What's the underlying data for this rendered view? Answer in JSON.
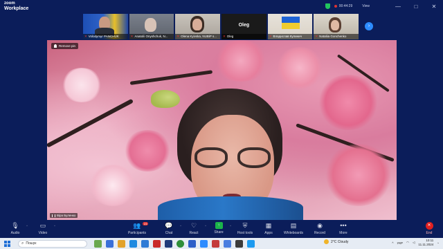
{
  "app": {
    "brand_line1": "zoom",
    "brand_line2": "Workplace"
  },
  "titlebar": {
    "timer": "00:44:29",
    "view_label": "View",
    "minimize": "—",
    "maximize": "□",
    "close": "✕"
  },
  "thumbnails": [
    {
      "name": "Volodymyr PANCHUK"
    },
    {
      "name": "Anatolii Onyshchuk, N..."
    },
    {
      "name": "Olena Kyivska, NUBiP s..."
    },
    {
      "name": "Oleg",
      "center_name": "Oleg"
    },
    {
      "name": "Владислав Кулинич"
    },
    {
      "name": "Nataliia Gonchenko"
    }
  ],
  "video": {
    "remove_pin_label": "Remove pin",
    "speaker_label": "Віра Буленко"
  },
  "toolbar": {
    "items": [
      {
        "label": "Audio",
        "icon": "microphone-icon"
      },
      {
        "label": "Video",
        "icon": "camera-icon"
      },
      {
        "label": "Participants",
        "icon": "participants-icon",
        "badge": "23"
      },
      {
        "label": "Chat",
        "icon": "chat-icon"
      },
      {
        "label": "React",
        "icon": "heart-icon"
      },
      {
        "label": "Share",
        "icon": "share-icon"
      },
      {
        "label": "Host tools",
        "icon": "shield-icon"
      },
      {
        "label": "Apps",
        "icon": "apps-icon"
      },
      {
        "label": "Whiteboards",
        "icon": "whiteboard-icon"
      },
      {
        "label": "Record",
        "icon": "record-icon"
      },
      {
        "label": "More",
        "icon": "more-icon"
      },
      {
        "label": "End",
        "icon": "end-icon"
      }
    ]
  },
  "taskbar": {
    "search_placeholder": "Пошук",
    "weather": "2°C Cloudy",
    "language": "УКР",
    "time": "10:11",
    "date": "11.11.2024"
  },
  "colors": {
    "accent": "#2d8cff",
    "end_red": "#e02020",
    "share_green": "#1bb34a",
    "background": "#0b1d5a"
  }
}
